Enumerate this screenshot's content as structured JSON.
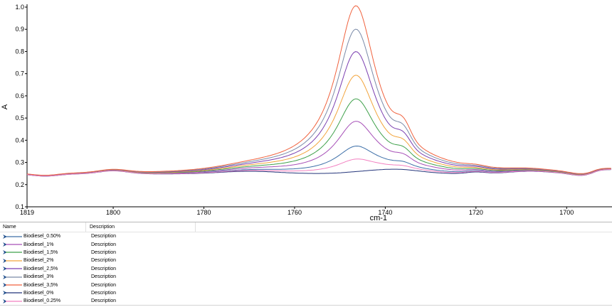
{
  "chart_data": {
    "type": "line",
    "title": "",
    "xlabel": "cm-1",
    "ylabel": "A",
    "xlim": [
      1819,
      1690
    ],
    "ylim": [
      0.1,
      1.0
    ],
    "x_reversed": true,
    "grid": false,
    "x_ticks": [
      1819,
      1800,
      1780,
      1760,
      1740,
      1720,
      1700
    ],
    "y_ticks": [
      0.1,
      0.2,
      0.3,
      0.4,
      0.5,
      0.6,
      0.7,
      0.8,
      0.9,
      1.0
    ],
    "x_tick_labels": [
      "1819",
      "1800",
      "1780",
      "1760",
      "1740",
      "1720",
      "1700"
    ],
    "y_tick_labels": [
      "0.1",
      "0.2",
      "0.3",
      "0.4",
      "0.5",
      "0.6",
      "0.7",
      "0.8",
      "0.9",
      "1.0"
    ],
    "peak_x": 1746.5,
    "series": [
      {
        "name": "Biodiesel_0.50%",
        "color": "#3d6fa8",
        "peak": 0.38
      },
      {
        "name": "Biodiesel_1%",
        "color": "#a64fb7",
        "peak": 0.485
      },
      {
        "name": "Biodiesel_1,5%",
        "color": "#3ea04a",
        "peak": 0.58
      },
      {
        "name": "Biodiesel_2%",
        "color": "#f2a43c",
        "peak": 0.68
      },
      {
        "name": "Biodiesel_2,5%",
        "color": "#7b3fb0",
        "peak": 0.78
      },
      {
        "name": "Biodiesel_3%",
        "color": "#7a8aa8",
        "peak": 0.875
      },
      {
        "name": "Biodiesel_3,5%",
        "color": "#f0623e",
        "peak": 0.975
      },
      {
        "name": "Biodiesel_0%",
        "color": "#23347a",
        "peak": 0.272
      },
      {
        "name": "Biodiesel_0.25%",
        "color": "#f27fc0",
        "peak": 0.325
      }
    ]
  },
  "legend": {
    "header_name": "Name",
    "header_description": "Description",
    "rows": [
      {
        "name": "Biodiesel_0.50%",
        "description": "Description",
        "color": "#3d6fa8"
      },
      {
        "name": "Biodiesel_1%",
        "description": "Description",
        "color": "#a64fb7"
      },
      {
        "name": "Biodiesel_1,5%",
        "description": "Description",
        "color": "#3ea04a"
      },
      {
        "name": "Biodiesel_2%",
        "description": "Description",
        "color": "#f2a43c"
      },
      {
        "name": "Biodiesel_2,5%",
        "description": "Description",
        "color": "#7b3fb0"
      },
      {
        "name": "Biodiesel_3%",
        "description": "Description",
        "color": "#7a8aa8"
      },
      {
        "name": "Biodiesel_3,5%",
        "description": "Description",
        "color": "#f0623e"
      },
      {
        "name": "Biodiesel_0%",
        "description": "Description",
        "color": "#23347a"
      },
      {
        "name": "Biodiesel_0.25%",
        "description": "Description",
        "color": "#f27fc0"
      }
    ]
  }
}
